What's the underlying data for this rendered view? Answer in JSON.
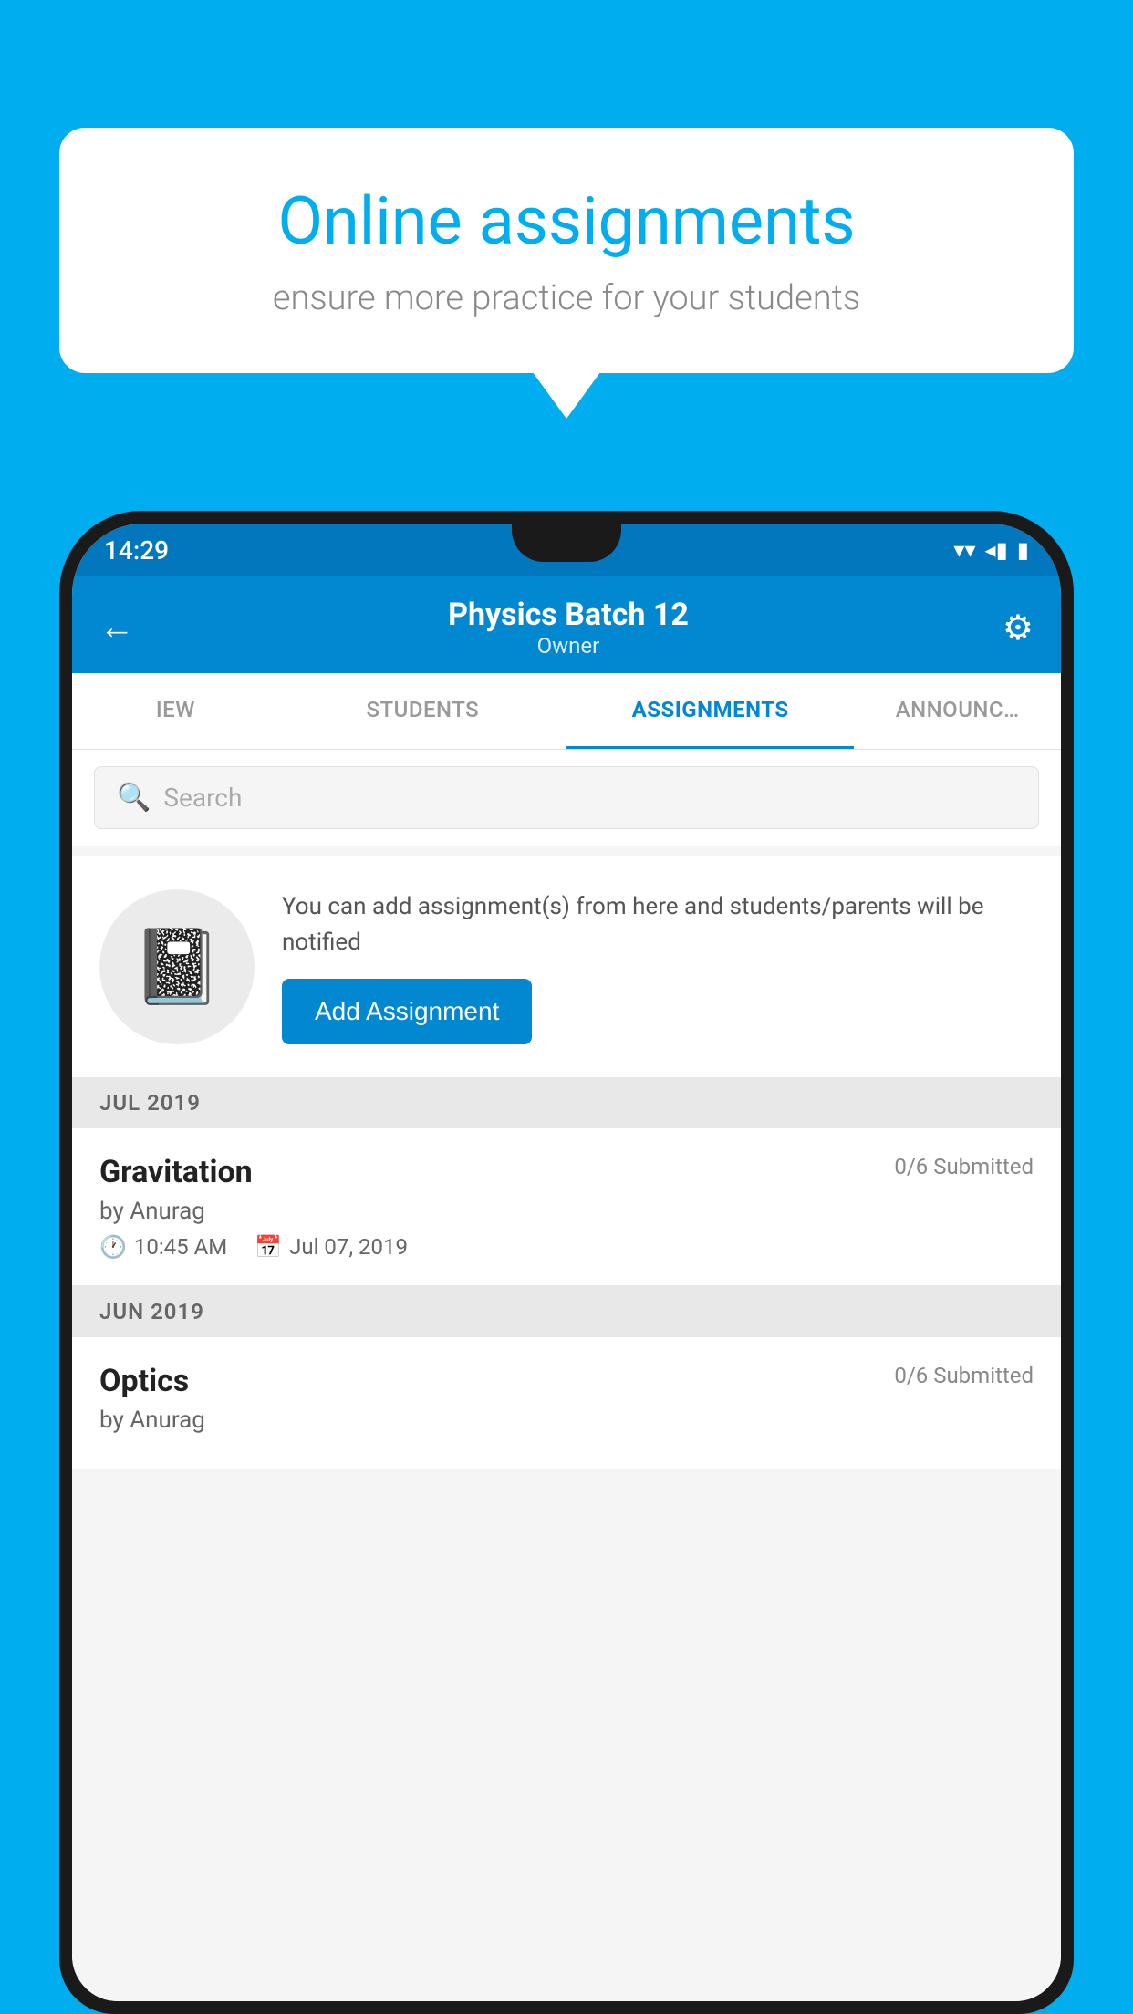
{
  "background_color": "#00AEEF",
  "speech_bubble": {
    "title": "Online assignments",
    "subtitle": "ensure more practice for your students"
  },
  "phone": {
    "status_bar": {
      "time": "14:29",
      "wifi_icon": "▼",
      "signal_icon": "◀",
      "battery_icon": "▮"
    },
    "header": {
      "title": "Physics Batch 12",
      "subtitle": "Owner",
      "back_icon": "←",
      "settings_icon": "⚙"
    },
    "tabs": [
      {
        "label": "IEW",
        "active": false
      },
      {
        "label": "STUDENTS",
        "active": false
      },
      {
        "label": "ASSIGNMENTS",
        "active": true
      },
      {
        "label": "ANNOUNCEM…",
        "active": false
      }
    ],
    "search": {
      "placeholder": "Search"
    },
    "promo": {
      "description": "You can add assignment(s) from here and students/parents will be notified",
      "button_label": "Add Assignment"
    },
    "sections": [
      {
        "label": "JUL 2019",
        "assignments": [
          {
            "name": "Gravitation",
            "submitted": "0/6 Submitted",
            "by": "by Anurag",
            "time": "10:45 AM",
            "date": "Jul 07, 2019"
          }
        ]
      },
      {
        "label": "JUN 2019",
        "assignments": [
          {
            "name": "Optics",
            "submitted": "0/6 Submitted",
            "by": "by Anurag",
            "time": "",
            "date": ""
          }
        ]
      }
    ]
  }
}
